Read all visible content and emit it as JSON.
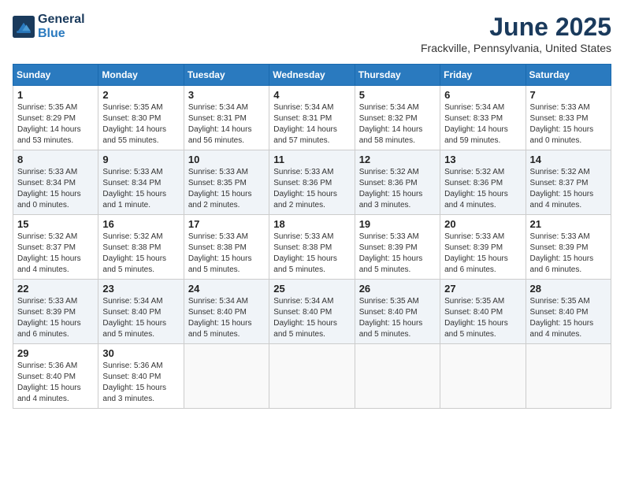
{
  "header": {
    "logo_line1": "General",
    "logo_line2": "Blue",
    "month": "June 2025",
    "location": "Frackville, Pennsylvania, United States"
  },
  "days_of_week": [
    "Sunday",
    "Monday",
    "Tuesday",
    "Wednesday",
    "Thursday",
    "Friday",
    "Saturday"
  ],
  "weeks": [
    [
      {
        "day": "1",
        "info": "Sunrise: 5:35 AM\nSunset: 8:29 PM\nDaylight: 14 hours\nand 53 minutes."
      },
      {
        "day": "2",
        "info": "Sunrise: 5:35 AM\nSunset: 8:30 PM\nDaylight: 14 hours\nand 55 minutes."
      },
      {
        "day": "3",
        "info": "Sunrise: 5:34 AM\nSunset: 8:31 PM\nDaylight: 14 hours\nand 56 minutes."
      },
      {
        "day": "4",
        "info": "Sunrise: 5:34 AM\nSunset: 8:31 PM\nDaylight: 14 hours\nand 57 minutes."
      },
      {
        "day": "5",
        "info": "Sunrise: 5:34 AM\nSunset: 8:32 PM\nDaylight: 14 hours\nand 58 minutes."
      },
      {
        "day": "6",
        "info": "Sunrise: 5:34 AM\nSunset: 8:33 PM\nDaylight: 14 hours\nand 59 minutes."
      },
      {
        "day": "7",
        "info": "Sunrise: 5:33 AM\nSunset: 8:33 PM\nDaylight: 15 hours\nand 0 minutes."
      }
    ],
    [
      {
        "day": "8",
        "info": "Sunrise: 5:33 AM\nSunset: 8:34 PM\nDaylight: 15 hours\nand 0 minutes."
      },
      {
        "day": "9",
        "info": "Sunrise: 5:33 AM\nSunset: 8:34 PM\nDaylight: 15 hours\nand 1 minute."
      },
      {
        "day": "10",
        "info": "Sunrise: 5:33 AM\nSunset: 8:35 PM\nDaylight: 15 hours\nand 2 minutes."
      },
      {
        "day": "11",
        "info": "Sunrise: 5:33 AM\nSunset: 8:36 PM\nDaylight: 15 hours\nand 2 minutes."
      },
      {
        "day": "12",
        "info": "Sunrise: 5:32 AM\nSunset: 8:36 PM\nDaylight: 15 hours\nand 3 minutes."
      },
      {
        "day": "13",
        "info": "Sunrise: 5:32 AM\nSunset: 8:36 PM\nDaylight: 15 hours\nand 4 minutes."
      },
      {
        "day": "14",
        "info": "Sunrise: 5:32 AM\nSunset: 8:37 PM\nDaylight: 15 hours\nand 4 minutes."
      }
    ],
    [
      {
        "day": "15",
        "info": "Sunrise: 5:32 AM\nSunset: 8:37 PM\nDaylight: 15 hours\nand 4 minutes."
      },
      {
        "day": "16",
        "info": "Sunrise: 5:32 AM\nSunset: 8:38 PM\nDaylight: 15 hours\nand 5 minutes."
      },
      {
        "day": "17",
        "info": "Sunrise: 5:33 AM\nSunset: 8:38 PM\nDaylight: 15 hours\nand 5 minutes."
      },
      {
        "day": "18",
        "info": "Sunrise: 5:33 AM\nSunset: 8:38 PM\nDaylight: 15 hours\nand 5 minutes."
      },
      {
        "day": "19",
        "info": "Sunrise: 5:33 AM\nSunset: 8:39 PM\nDaylight: 15 hours\nand 5 minutes."
      },
      {
        "day": "20",
        "info": "Sunrise: 5:33 AM\nSunset: 8:39 PM\nDaylight: 15 hours\nand 6 minutes."
      },
      {
        "day": "21",
        "info": "Sunrise: 5:33 AM\nSunset: 8:39 PM\nDaylight: 15 hours\nand 6 minutes."
      }
    ],
    [
      {
        "day": "22",
        "info": "Sunrise: 5:33 AM\nSunset: 8:39 PM\nDaylight: 15 hours\nand 6 minutes."
      },
      {
        "day": "23",
        "info": "Sunrise: 5:34 AM\nSunset: 8:40 PM\nDaylight: 15 hours\nand 5 minutes."
      },
      {
        "day": "24",
        "info": "Sunrise: 5:34 AM\nSunset: 8:40 PM\nDaylight: 15 hours\nand 5 minutes."
      },
      {
        "day": "25",
        "info": "Sunrise: 5:34 AM\nSunset: 8:40 PM\nDaylight: 15 hours\nand 5 minutes."
      },
      {
        "day": "26",
        "info": "Sunrise: 5:35 AM\nSunset: 8:40 PM\nDaylight: 15 hours\nand 5 minutes."
      },
      {
        "day": "27",
        "info": "Sunrise: 5:35 AM\nSunset: 8:40 PM\nDaylight: 15 hours\nand 5 minutes."
      },
      {
        "day": "28",
        "info": "Sunrise: 5:35 AM\nSunset: 8:40 PM\nDaylight: 15 hours\nand 4 minutes."
      }
    ],
    [
      {
        "day": "29",
        "info": "Sunrise: 5:36 AM\nSunset: 8:40 PM\nDaylight: 15 hours\nand 4 minutes."
      },
      {
        "day": "30",
        "info": "Sunrise: 5:36 AM\nSunset: 8:40 PM\nDaylight: 15 hours\nand 3 minutes."
      },
      {
        "day": "",
        "info": ""
      },
      {
        "day": "",
        "info": ""
      },
      {
        "day": "",
        "info": ""
      },
      {
        "day": "",
        "info": ""
      },
      {
        "day": "",
        "info": ""
      }
    ]
  ]
}
